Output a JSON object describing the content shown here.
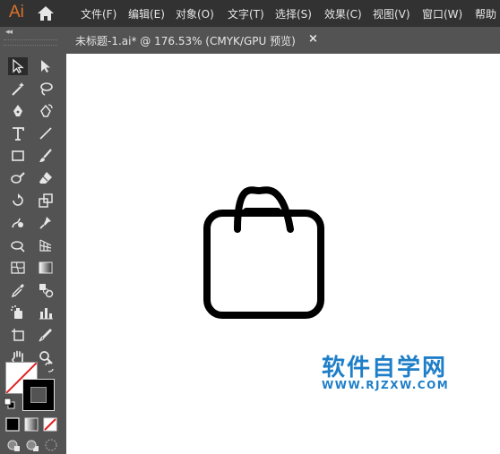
{
  "app": {
    "logo": "Ai"
  },
  "menu": [
    "文件(F)",
    "编辑(E)",
    "对象(O)",
    "文字(T)",
    "选择(S)",
    "效果(C)",
    "视图(V)",
    "窗口(W)",
    "帮助"
  ],
  "document": {
    "tab_title": "未标题-1.ai* @ 176.53% (CMYK/GPU 预览)",
    "close": "×"
  },
  "watermark": {
    "main": "软件自学网",
    "sub": "WWW.RJZXW.COM"
  },
  "toolbar": {
    "collapse": "◂◂"
  },
  "colors": {
    "fill": "#ffffff",
    "stroke": "#000000",
    "accent": "#1e7ec8",
    "logo": "#d9732b"
  }
}
